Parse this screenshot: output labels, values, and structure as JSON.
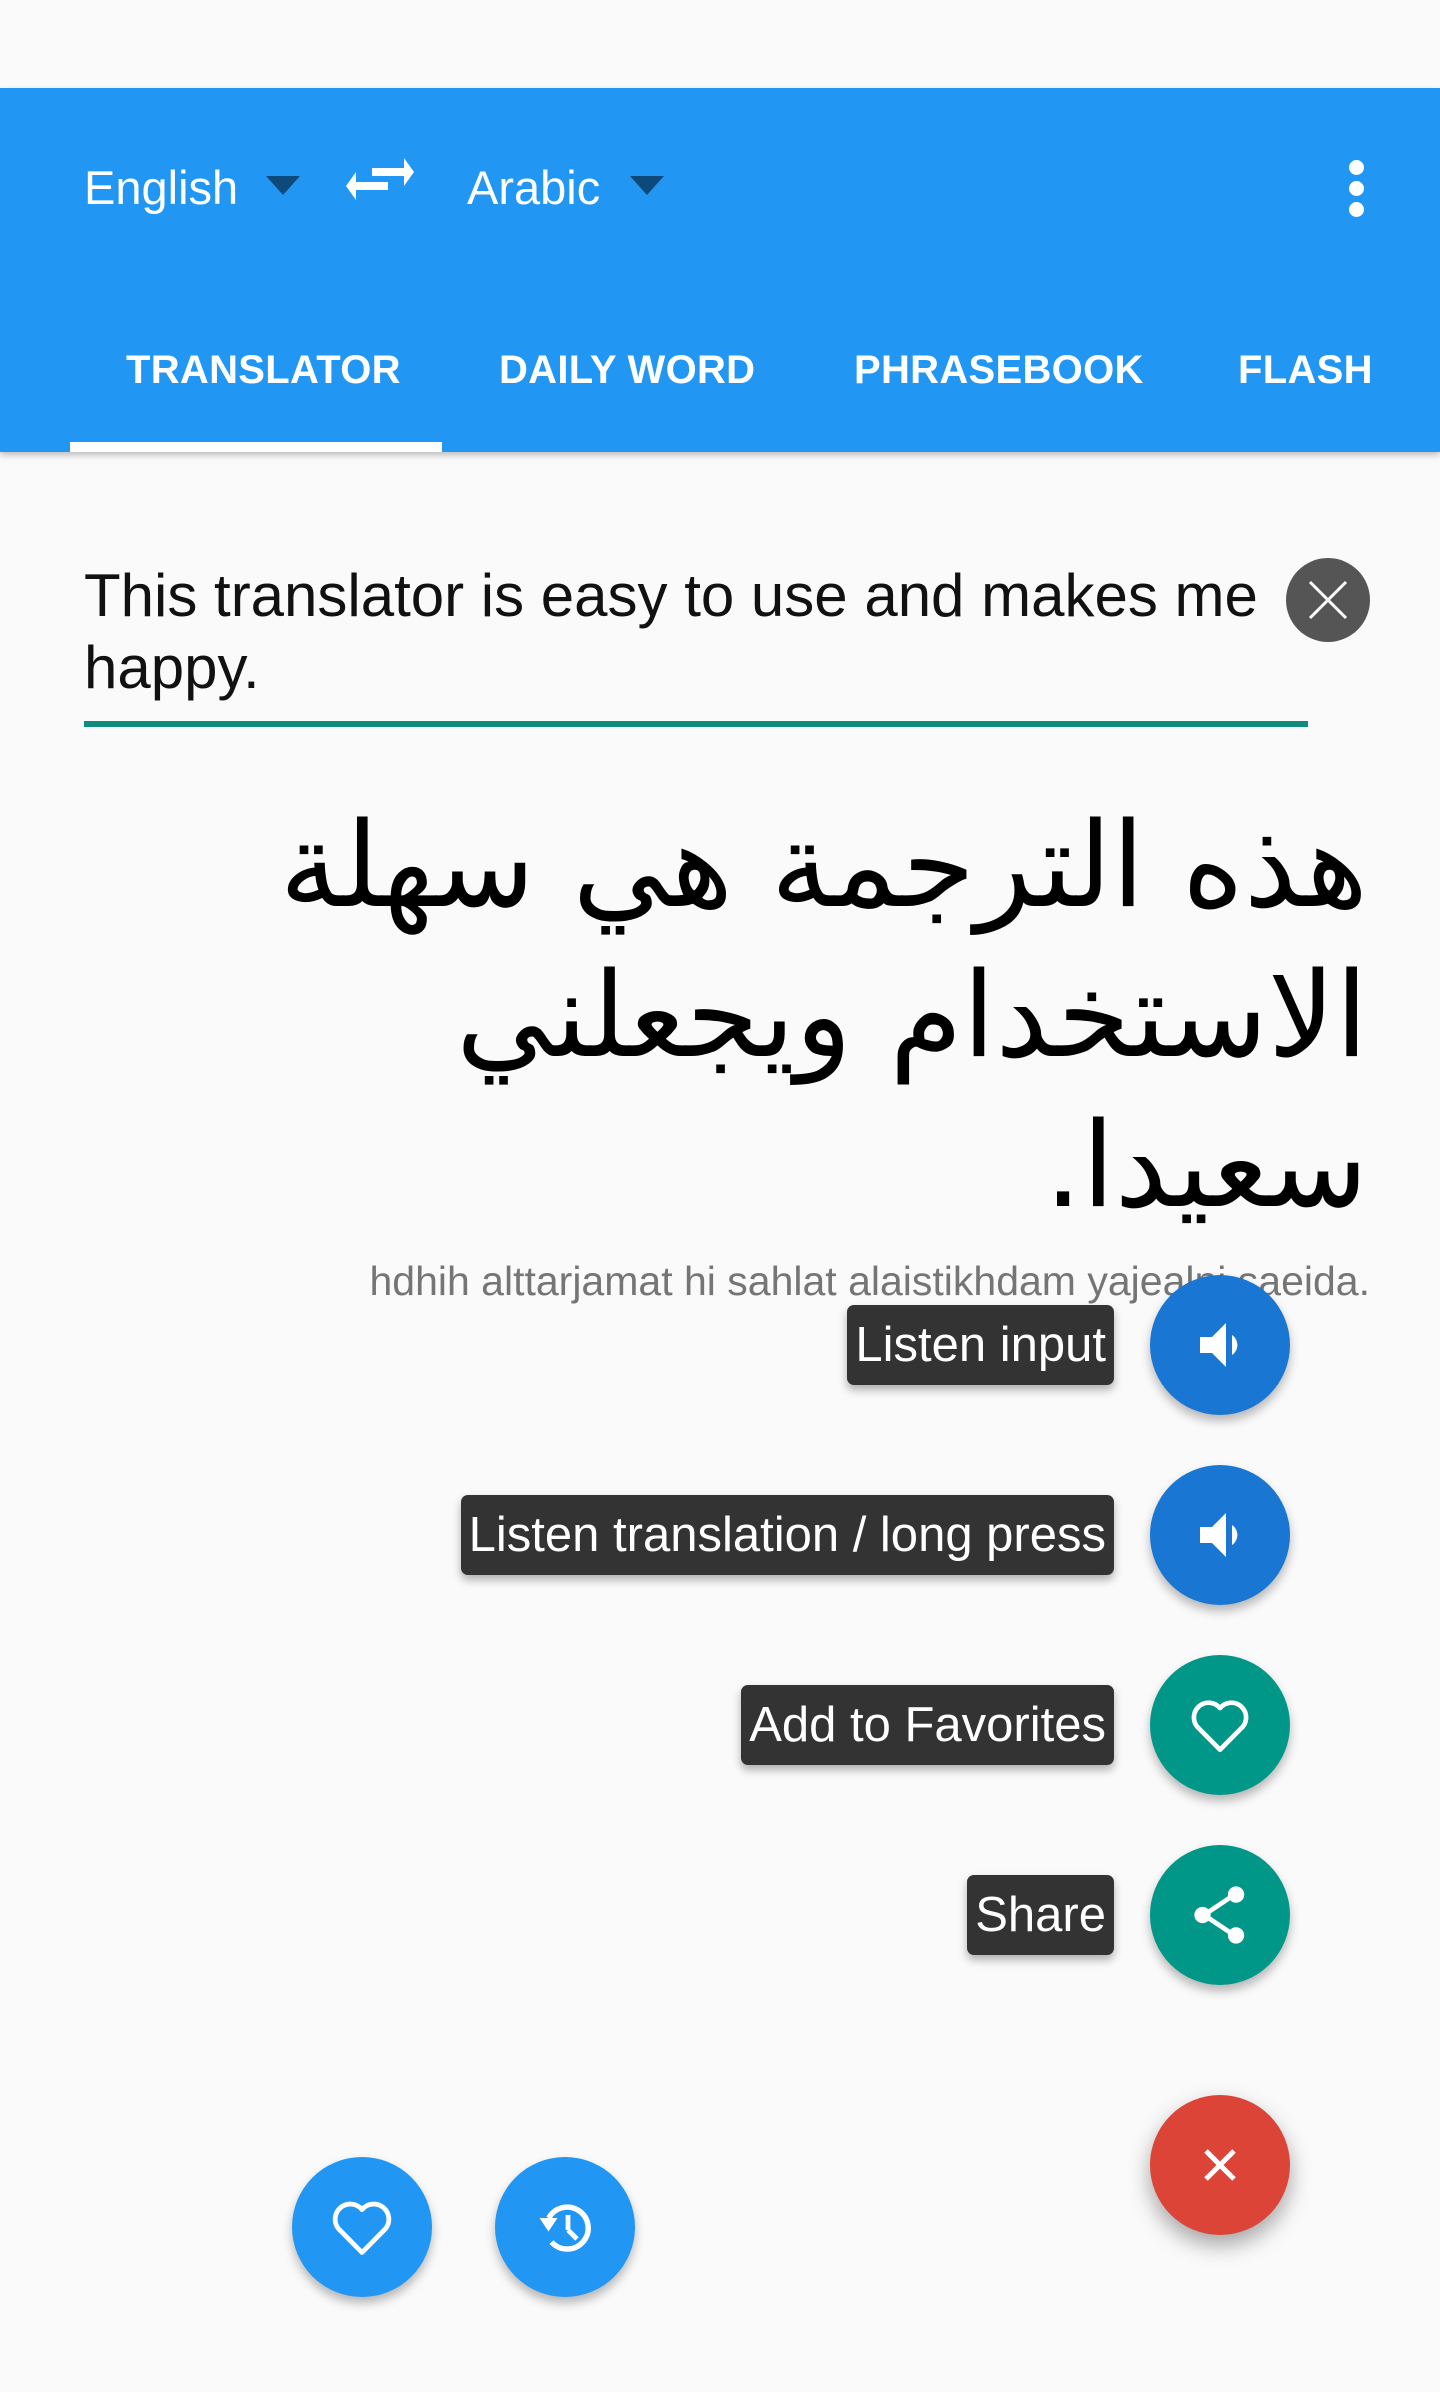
{
  "header": {
    "source_language": "English",
    "target_language": "Arabic",
    "swap_icon": "swap-horiz-icon",
    "overflow_icon": "more-vert-icon"
  },
  "tabs": [
    {
      "label": "TRANSLATOR",
      "active": true
    },
    {
      "label": "DAILY WORD",
      "active": false
    },
    {
      "label": "PHRASEBOOK",
      "active": false
    },
    {
      "label": "FLASH",
      "active": false
    }
  ],
  "input": {
    "value": "This translator is easy to use and makes me happy.",
    "clear_icon": "close-icon"
  },
  "translation": {
    "text": "هذه الترجمة هي سهلة الاستخدام ويجعلني سعيدا.",
    "transliteration": "hdhih alttarjamat hi sahlat alaistikhdam yajealni saeida."
  },
  "speed_dial": {
    "actions": [
      {
        "label": "Listen input",
        "icon": "volume-icon",
        "color": "#1976D2"
      },
      {
        "label": "Listen translation / long press",
        "icon": "volume-icon",
        "color": "#1976D2"
      },
      {
        "label": "Add to Favorites",
        "icon": "heart-outline-icon",
        "color": "#009688"
      },
      {
        "label": "Share",
        "icon": "share-icon",
        "color": "#009688"
      }
    ],
    "main_icon": "close-icon",
    "main_color": "#DB4437"
  },
  "bottom_buttons": [
    {
      "name": "favorites",
      "icon": "heart-outline-icon",
      "color": "#2196F3"
    },
    {
      "name": "history",
      "icon": "history-icon",
      "color": "#2196F3"
    }
  ],
  "colors": {
    "app_bar": "#2196F3",
    "input_underline": "#0e8c7f"
  }
}
